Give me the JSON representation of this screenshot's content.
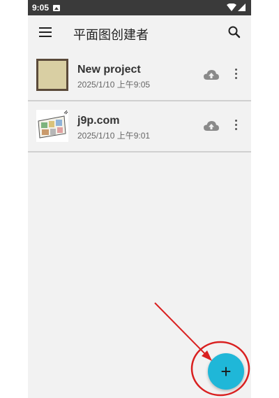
{
  "status_bar": {
    "time": "9:05"
  },
  "app_bar": {
    "title": "平面图创建者"
  },
  "projects": [
    {
      "name": "New project",
      "date": "2025/1/10 上午9:05"
    },
    {
      "name": "j9p.com",
      "date": "2025/1/10 上午9:01"
    }
  ],
  "fab": {
    "label": "+"
  },
  "colors": {
    "fab": "#1fb7d8",
    "annotation": "#d92020",
    "status_bar": "#3a3a3a"
  },
  "icons": [
    "menu-icon",
    "search-icon",
    "cloud-upload-icon",
    "more-vert-icon",
    "add-icon"
  ]
}
